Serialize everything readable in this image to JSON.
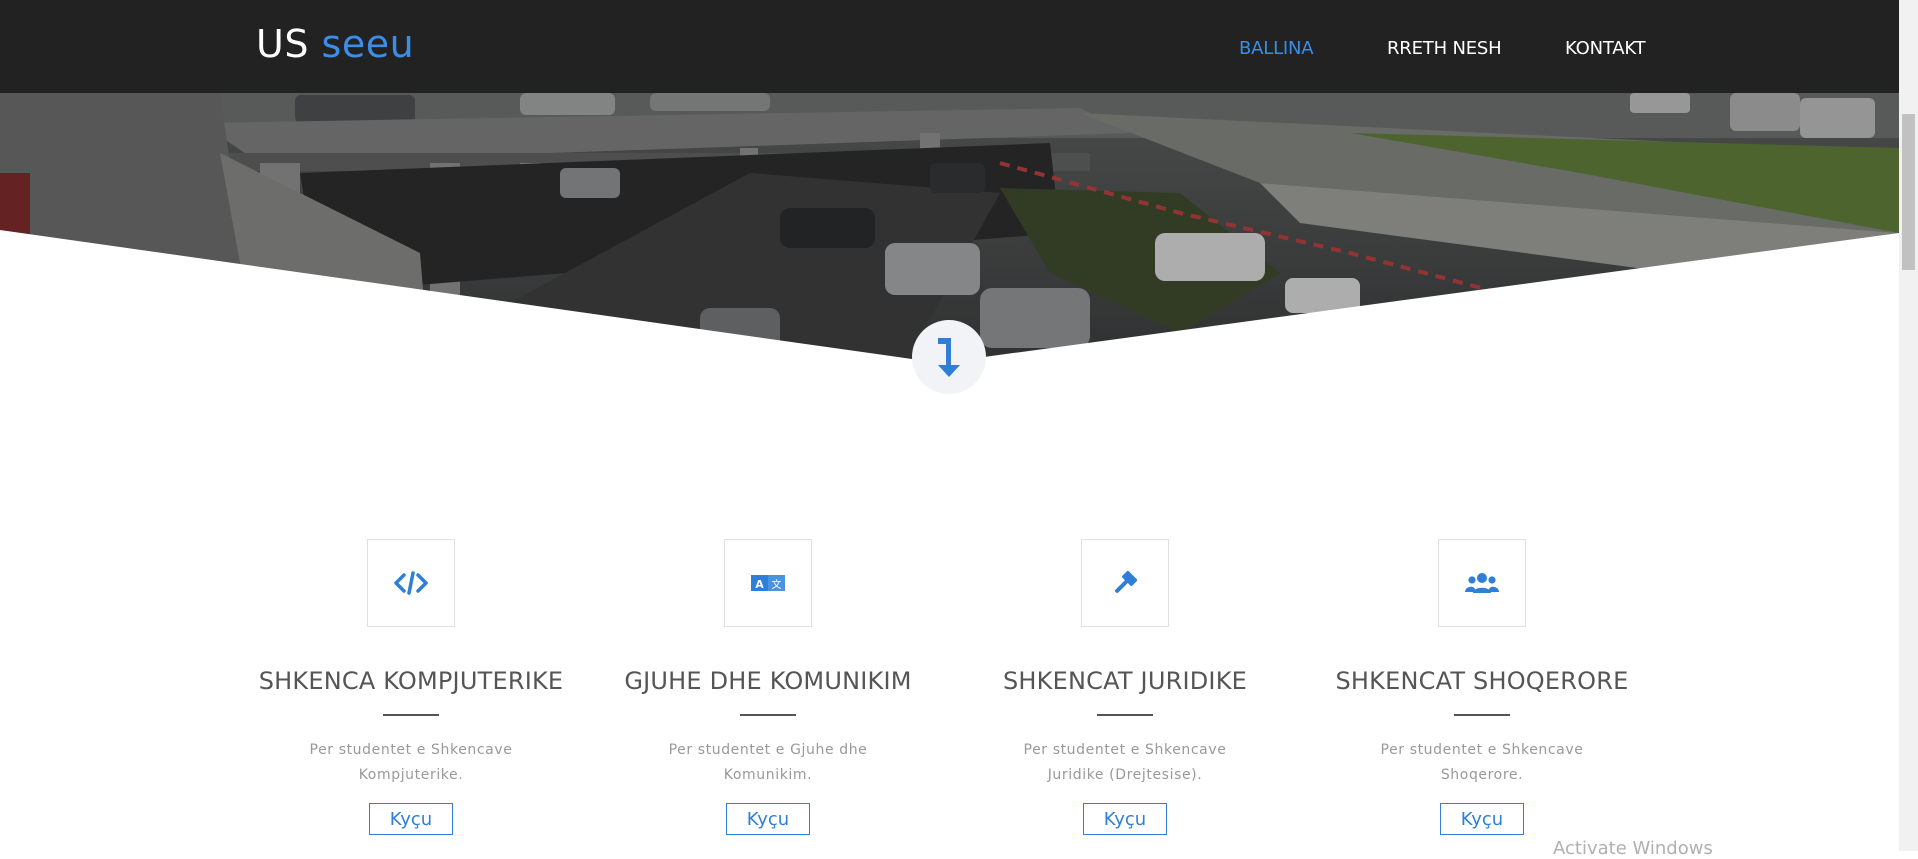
{
  "brand": {
    "prefix": "US",
    "accent": "seeu"
  },
  "nav": [
    {
      "label": "BALLINA",
      "active": true
    },
    {
      "label": "RRETH NESH",
      "active": false
    },
    {
      "label": "KONTAKT",
      "active": false
    }
  ],
  "cards": [
    {
      "icon": "code-icon",
      "title": "SHKENCA KOMPJUTERIKE",
      "desc": "Per studentet e Shkencave Kompjuterike.",
      "button": "Kyçu"
    },
    {
      "icon": "translate-icon",
      "title": "GJUHE DHE KOMUNIKIM",
      "desc": "Per studentet e Gjuhe dhe Komunikim.",
      "button": "Kyçu"
    },
    {
      "icon": "gavel-icon",
      "title": "SHKENCAT JURIDIKE",
      "desc": "Per studentet e Shkencave Juridike (Drejtesise).",
      "button": "Kyçu"
    },
    {
      "icon": "users-icon",
      "title": "SHKENCAT SHOQERORE",
      "desc": "Per studentet e Shkencave Shoqerore.",
      "button": "Kyçu"
    }
  ],
  "watermark_partial": "Activate Windows",
  "colors": {
    "accent": "#3a8ee8",
    "navbar": "#222222",
    "button": "#2f7fd8"
  },
  "scroll_icon": "arrow-down-icon"
}
